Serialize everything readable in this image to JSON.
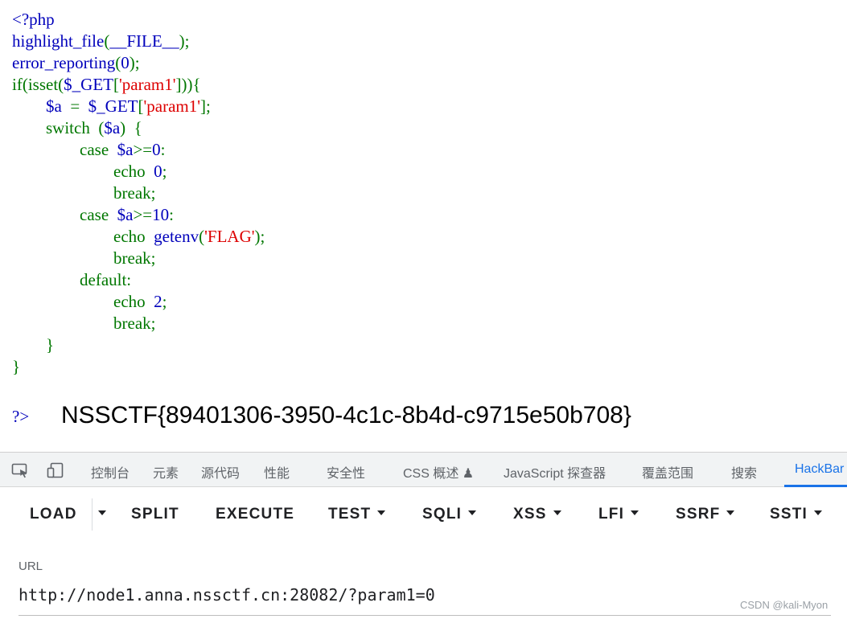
{
  "source_code": {
    "lines": [
      [
        {
          "t": "<?php",
          "c": "default"
        }
      ],
      [
        {
          "t": "highlight_file",
          "c": "default"
        },
        {
          "t": "(",
          "c": "keyword"
        },
        {
          "t": "__FILE__",
          "c": "default"
        },
        {
          "t": ");",
          "c": "keyword"
        }
      ],
      [
        {
          "t": "error_reporting",
          "c": "default"
        },
        {
          "t": "(",
          "c": "keyword"
        },
        {
          "t": "0",
          "c": "default"
        },
        {
          "t": ");",
          "c": "keyword"
        }
      ],
      [
        {
          "t": "if(isset(",
          "c": "keyword"
        },
        {
          "t": "$_GET",
          "c": "default"
        },
        {
          "t": "[",
          "c": "keyword"
        },
        {
          "t": "'param1'",
          "c": "string"
        },
        {
          "t": "])){",
          "c": "keyword"
        }
      ],
      [
        {
          "t": "        ",
          "c": "keyword"
        },
        {
          "t": "$a",
          "c": "default"
        },
        {
          "t": "  =  ",
          "c": "keyword"
        },
        {
          "t": "$_GET",
          "c": "default"
        },
        {
          "t": "[",
          "c": "keyword"
        },
        {
          "t": "'param1'",
          "c": "string"
        },
        {
          "t": "];",
          "c": "keyword"
        }
      ],
      [
        {
          "t": "        switch  (",
          "c": "keyword"
        },
        {
          "t": "$a",
          "c": "default"
        },
        {
          "t": ")  {",
          "c": "keyword"
        }
      ],
      [
        {
          "t": "                case  ",
          "c": "keyword"
        },
        {
          "t": "$a",
          "c": "default"
        },
        {
          "t": ">=",
          "c": "keyword"
        },
        {
          "t": "0",
          "c": "default"
        },
        {
          "t": ":",
          "c": "keyword"
        }
      ],
      [
        {
          "t": "                        echo  ",
          "c": "keyword"
        },
        {
          "t": "0",
          "c": "default"
        },
        {
          "t": ";",
          "c": "keyword"
        }
      ],
      [
        {
          "t": "                        break;",
          "c": "keyword"
        }
      ],
      [
        {
          "t": "                case  ",
          "c": "keyword"
        },
        {
          "t": "$a",
          "c": "default"
        },
        {
          "t": ">=",
          "c": "keyword"
        },
        {
          "t": "10",
          "c": "default"
        },
        {
          "t": ":",
          "c": "keyword"
        }
      ],
      [
        {
          "t": "                        echo  ",
          "c": "keyword"
        },
        {
          "t": "getenv",
          "c": "default"
        },
        {
          "t": "(",
          "c": "keyword"
        },
        {
          "t": "'FLAG'",
          "c": "string"
        },
        {
          "t": ");",
          "c": "keyword"
        }
      ],
      [
        {
          "t": "                        break;",
          "c": "keyword"
        }
      ],
      [
        {
          "t": "                default:",
          "c": "keyword"
        }
      ],
      [
        {
          "t": "                        echo  ",
          "c": "keyword"
        },
        {
          "t": "2",
          "c": "default"
        },
        {
          "t": ";",
          "c": "keyword"
        }
      ],
      [
        {
          "t": "                        break;",
          "c": "keyword"
        }
      ],
      [
        {
          "t": "        }",
          "c": "keyword"
        }
      ],
      [
        {
          "t": "}",
          "c": "keyword"
        }
      ],
      [
        {
          "t": "",
          "c": "default"
        }
      ]
    ],
    "close_tag": "?>",
    "colors": {
      "default": "#0000BB",
      "keyword": "#007700",
      "string": "#DD0000"
    }
  },
  "output": {
    "flag": "NSSCTF{89401306-3950-4c1c-8b4d-c9715e50b708}"
  },
  "devtools": {
    "icons": [
      "inspect-element-icon",
      "device-toolbar-icon"
    ],
    "tabs": [
      {
        "label": "控制台",
        "active": false
      },
      {
        "label": "元素",
        "active": false
      },
      {
        "label": "源代码",
        "active": false
      },
      {
        "label": "性能",
        "active": false
      },
      {
        "label": "安全性",
        "active": false
      },
      {
        "label": "CSS 概述 ♟",
        "active": false
      },
      {
        "label": "JavaScript 探查器",
        "active": false
      },
      {
        "label": "覆盖范围",
        "active": false
      },
      {
        "label": "搜索",
        "active": false
      },
      {
        "label": "HackBar",
        "active": true
      }
    ],
    "accent_color": "#1a73e8"
  },
  "hackbar": {
    "toolbar": [
      {
        "label": "LOAD",
        "dropdown": false
      },
      {
        "label": "",
        "dropdown": true
      },
      {
        "label": "SPLIT",
        "dropdown": false
      },
      {
        "label": "EXECUTE",
        "dropdown": false
      },
      {
        "label": "TEST",
        "dropdown": true
      },
      {
        "label": "SQLI",
        "dropdown": true
      },
      {
        "label": "XSS",
        "dropdown": true
      },
      {
        "label": "LFI",
        "dropdown": true
      },
      {
        "label": "SSRF",
        "dropdown": true
      },
      {
        "label": "SSTI",
        "dropdown": true
      }
    ],
    "url_label": "URL",
    "url_value": "http://node1.anna.nssctf.cn:28082/?param1=0"
  },
  "watermark": "CSDN @kali-Myon"
}
